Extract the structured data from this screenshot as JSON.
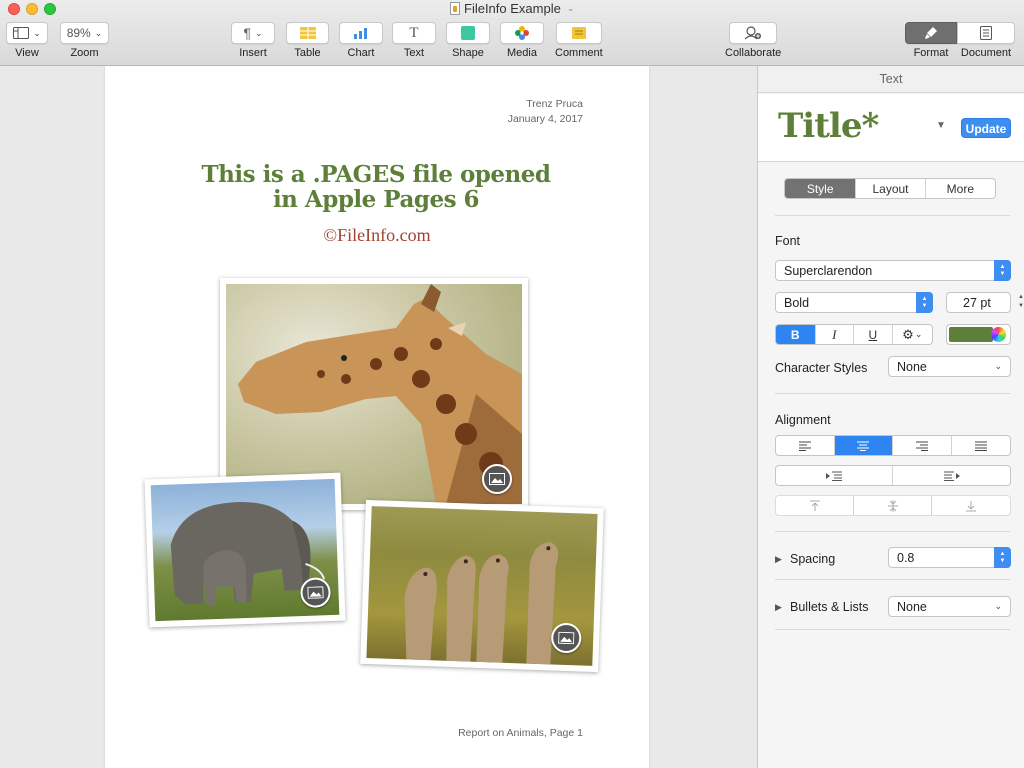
{
  "window": {
    "title": "FileInfo Example"
  },
  "toolbar": {
    "view_label": "View",
    "zoom_value": "89%",
    "zoom_label": "Zoom",
    "insert_label": "Insert",
    "table_label": "Table",
    "chart_label": "Chart",
    "text_label": "Text",
    "shape_label": "Shape",
    "media_label": "Media",
    "comment_label": "Comment",
    "collaborate_label": "Collaborate",
    "format_label": "Format",
    "document_label": "Document"
  },
  "page": {
    "author": "Trenz Pruca",
    "date": "January 4, 2017",
    "title_line1": "This is a .PAGES file opened",
    "title_line2": "in Apple Pages 6",
    "credit": "©FileInfo.com",
    "footer": "Report on Animals, Page 1",
    "photos": [
      "giraffe",
      "elephants",
      "meerkats"
    ]
  },
  "inspector": {
    "header": "Text",
    "paragraph_style": "Title*",
    "update_label": "Update",
    "tabs": [
      "Style",
      "Layout",
      "More"
    ],
    "font_section": "Font",
    "font_family": "Superclarendon",
    "font_typeface": "Bold",
    "font_size": "27 pt",
    "bold_label": "B",
    "italic_label": "I",
    "underline_label": "U",
    "text_color": "#5d7f3a",
    "character_styles_label": "Character Styles",
    "character_styles_value": "None",
    "alignment_label": "Alignment",
    "spacing_label": "Spacing",
    "spacing_value": "0.8",
    "bullets_label": "Bullets & Lists",
    "bullets_value": "None"
  },
  "colors": {
    "title_green": "#5d7f3a",
    "credit_red": "#a2432f",
    "accent_blue": "#3d8ef0"
  }
}
